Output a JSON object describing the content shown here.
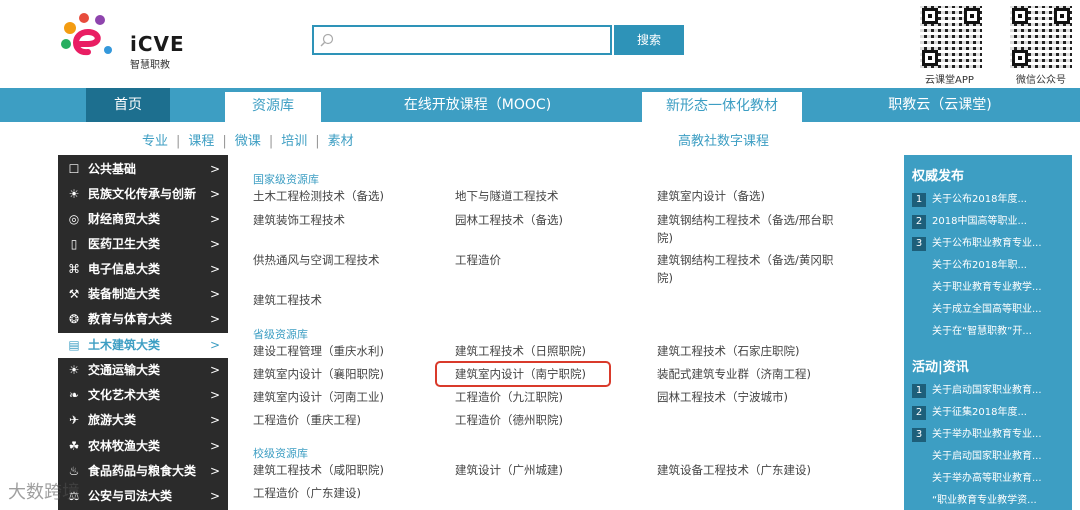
{
  "brand": {
    "logo_text": "iCVE",
    "logo_sub": "智慧职教",
    "colors": {
      "primary": "#3d9ec3",
      "dark_nav": "#1d6f8f",
      "highlight": "#d93a2b",
      "sidebar_bg": "#2b2b2b"
    }
  },
  "search": {
    "placeholder": "",
    "value": "",
    "button_label": "搜索"
  },
  "qr_codes": [
    {
      "label": "云课堂APP"
    },
    {
      "label": "微信公众号"
    }
  ],
  "nav": {
    "home": "首页",
    "items": [
      "资源库",
      "在线开放课程（MOOC)",
      "新形态一体化教材",
      "职教云（云课堂)"
    ],
    "active": [
      "资源库",
      "新形态一体化教材"
    ]
  },
  "subnav": {
    "left": [
      "专业",
      "课程",
      "微课",
      "培训",
      "素材"
    ],
    "right": "高教社数字课程"
  },
  "sidebar": {
    "items": [
      {
        "icon": "book-icon",
        "glyph": "☐",
        "label": "公共基础"
      },
      {
        "icon": "lamp-icon",
        "glyph": "☀",
        "label": "民族文化传承与创新"
      },
      {
        "icon": "target-icon",
        "glyph": "◎",
        "label": "财经商贸大类"
      },
      {
        "icon": "medicine-icon",
        "glyph": "▯",
        "label": "医药卫生大类"
      },
      {
        "icon": "share-icon",
        "glyph": "⌘",
        "label": "电子信息大类"
      },
      {
        "icon": "wrench-icon",
        "glyph": "⚒",
        "label": "装备制造大类"
      },
      {
        "icon": "ball-icon",
        "glyph": "❂",
        "label": "教育与体育大类"
      },
      {
        "icon": "building-icon",
        "glyph": "▤",
        "label": "土木建筑大类"
      },
      {
        "icon": "traffic-icon",
        "glyph": "☀",
        "label": "交通运输大类"
      },
      {
        "icon": "leaf-icon",
        "glyph": "❧",
        "label": "文化艺术大类"
      },
      {
        "icon": "travel-icon",
        "glyph": "✈",
        "label": "旅游大类"
      },
      {
        "icon": "plant-icon",
        "glyph": "☘",
        "label": "农林牧渔大类"
      },
      {
        "icon": "food-icon",
        "glyph": "♨",
        "label": "食品药品与粮食大类"
      },
      {
        "icon": "law-icon",
        "glyph": "⚖",
        "label": "公安与司法大类"
      }
    ],
    "arrow": ">",
    "active_index": 7
  },
  "content": {
    "national": {
      "title": "国家级资源库",
      "rows": [
        [
          "土木工程检测技术（备选)",
          "地下与隧道工程技术",
          "建筑室内设计（备选)"
        ],
        [
          "建筑装饰工程技术",
          "园林工程技术（备选)",
          "建筑钢结构工程技术（备选/邢台职院)"
        ],
        [
          "供热通风与空调工程技术",
          "工程造价",
          "建筑钢结构工程技术（备选/黄冈职院)"
        ],
        [
          "建筑工程技术",
          "",
          ""
        ]
      ]
    },
    "provincial": {
      "title": "省级资源库",
      "rows": [
        [
          "建设工程管理（重庆水利)",
          "建筑工程技术（日照职院)",
          "建筑工程技术（石家庄职院)"
        ],
        [
          "建筑室内设计（襄阳职院)",
          "建筑室内设计（南宁职院)",
          "装配式建筑专业群（济南工程)"
        ],
        [
          "建筑室内设计（河南工业)",
          "工程造价（九江职院)",
          "园林工程技术（宁波城市)"
        ],
        [
          "工程造价（重庆工程)",
          "工程造价（德州职院)",
          ""
        ]
      ]
    },
    "school": {
      "title": "校级资源库",
      "rows": [
        [
          "建筑工程技术（咸阳职院)",
          "建筑设计（广州城建)",
          "建筑设备工程技术（广东建设)"
        ],
        [
          "工程造价（广东建设)",
          "",
          ""
        ]
      ]
    }
  },
  "right_panel": {
    "authority": {
      "title": "权威发布",
      "items": [
        {
          "num": "1",
          "text": "关于公布2018年度..."
        },
        {
          "num": "2",
          "text": "2018中国高等职业..."
        },
        {
          "num": "3",
          "text": "关于公布职业教育专业..."
        },
        {
          "num": "",
          "text": "关于公布2018年职..."
        },
        {
          "num": "",
          "text": "关于职业教育专业教学..."
        },
        {
          "num": "",
          "text": "关于成立全国高等职业..."
        },
        {
          "num": "",
          "text": "关于在“智慧职教”开..."
        }
      ]
    },
    "news": {
      "title": "活动|资讯",
      "items": [
        {
          "num": "1",
          "text": "关于启动国家职业教育..."
        },
        {
          "num": "2",
          "text": "关于征集2018年度..."
        },
        {
          "num": "3",
          "text": "关于举办职业教育专业..."
        },
        {
          "num": "",
          "text": "关于启动国家职业教育..."
        },
        {
          "num": "",
          "text": "关于举办高等职业教育..."
        },
        {
          "num": "",
          "text": "“职业教育专业教学资..."
        }
      ]
    }
  },
  "watermark": "大数跨境"
}
